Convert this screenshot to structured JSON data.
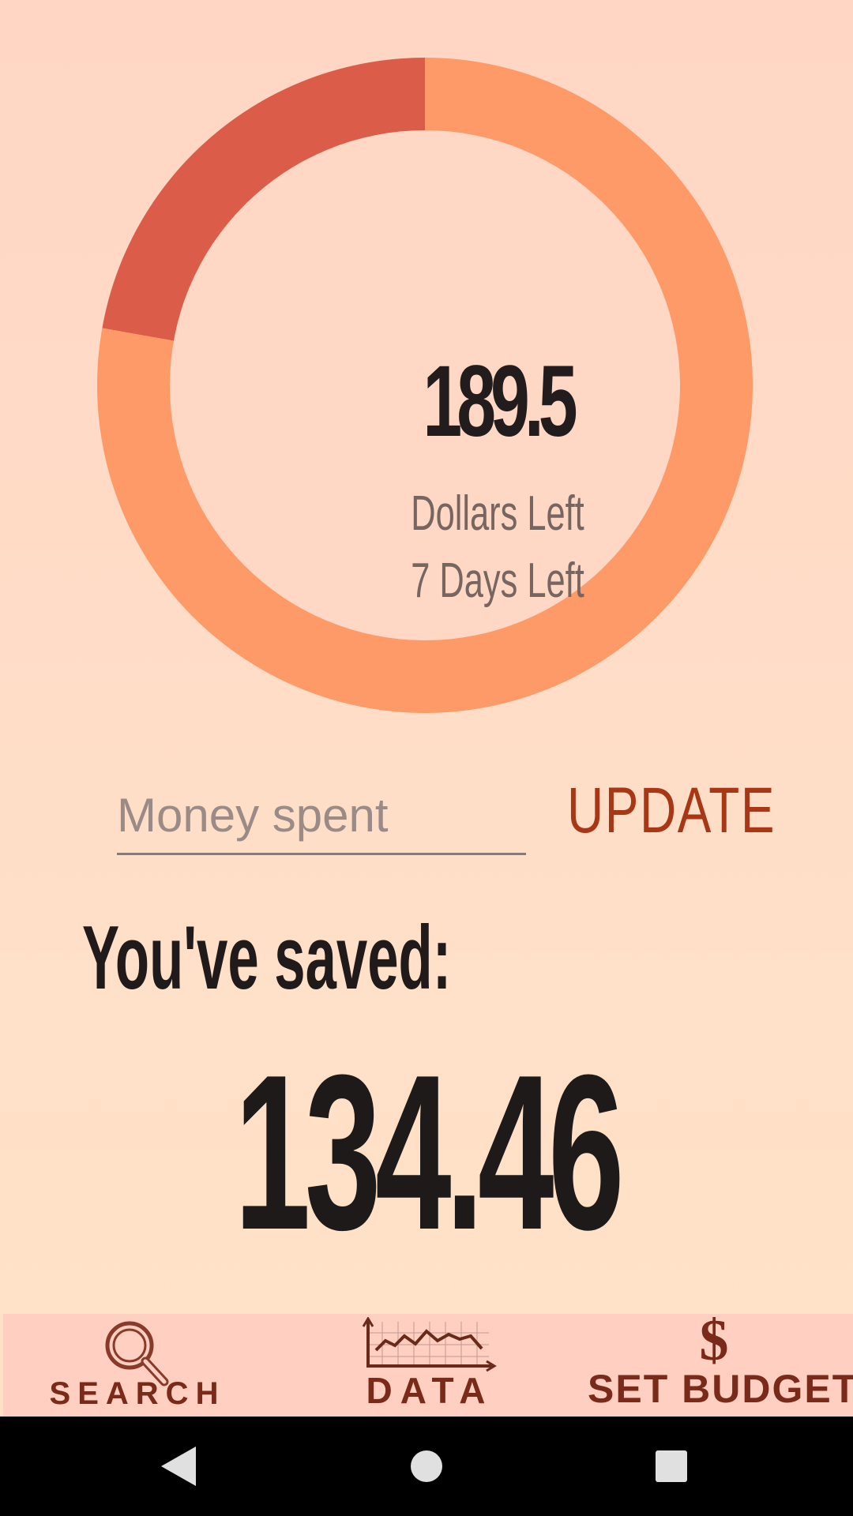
{
  "budget": {
    "remaining_amount": "189.5",
    "dollars_left_label": "Dollars Left",
    "days_left_label": "7 Days Left",
    "spent_fraction": 0.222,
    "remaining_color": "#FE9A68",
    "spent_color": "#DB5D49"
  },
  "spend_input": {
    "placeholder": "Money spent",
    "value": ""
  },
  "update_button": {
    "label": "UPDATE"
  },
  "savings": {
    "label": "You've saved:",
    "amount": "134.46"
  },
  "bottom_nav": {
    "items": [
      {
        "label": "SEARCH",
        "icon": "magnifier-icon"
      },
      {
        "label": "DATA",
        "icon": "line-chart-icon"
      },
      {
        "label": "SET BUDGET",
        "icon": "dollar-icon",
        "glyph": "$"
      }
    ]
  },
  "system_nav": {
    "buttons": [
      "back-icon",
      "home-icon",
      "recents-icon"
    ]
  }
}
